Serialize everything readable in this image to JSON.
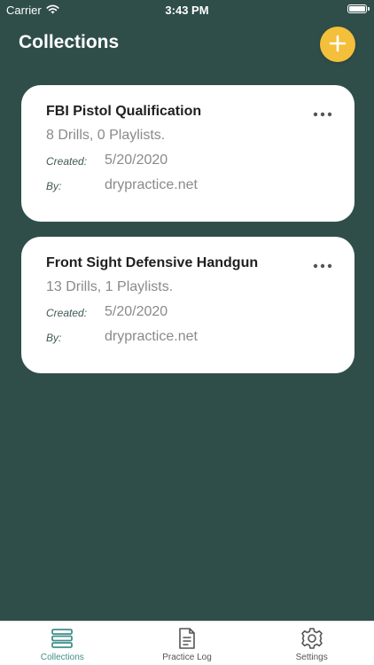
{
  "status_bar": {
    "carrier": "Carrier",
    "time": "3:43 PM"
  },
  "header": {
    "title": "Collections",
    "add_icon": "plus-icon"
  },
  "collections": [
    {
      "title": "FBI Pistol Qualification",
      "summary": "8 Drills, 0 Playlists.",
      "created_label": "Created:",
      "created_value": "5/20/2020",
      "by_label": "By:",
      "by_value": "drypractice.net"
    },
    {
      "title": "Front Sight Defensive Handgun",
      "summary": "13 Drills, 1 Playlists.",
      "created_label": "Created:",
      "created_value": "5/20/2020",
      "by_label": "By:",
      "by_value": "drypractice.net"
    }
  ],
  "tab_bar": {
    "tabs": [
      {
        "label": "Collections",
        "icon": "stack-icon",
        "active": true
      },
      {
        "label": "Practice Log",
        "icon": "document-icon",
        "active": false
      },
      {
        "label": "Settings",
        "icon": "gear-icon",
        "active": false
      }
    ]
  },
  "colors": {
    "background": "#2f4e4a",
    "accent": "#f4bf3a",
    "active_tab": "#3f8f8a"
  }
}
